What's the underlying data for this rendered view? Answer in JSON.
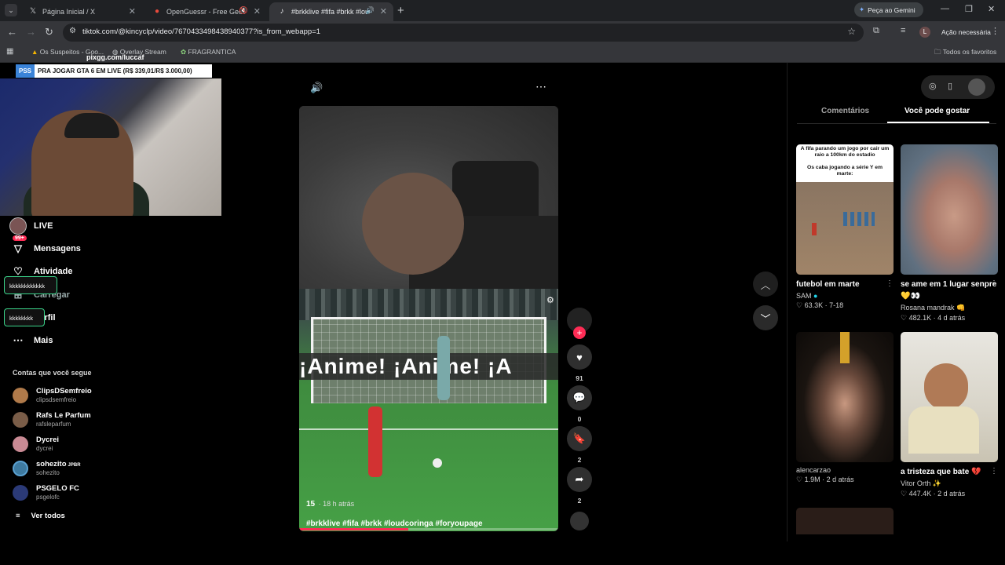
{
  "browser": {
    "tabs": [
      {
        "title": "Página Inicial / X",
        "icon": "x-logo-icon"
      },
      {
        "title": "OpenGuessr - Free GeoGuessr",
        "icon": "openguessr-icon"
      },
      {
        "title": "#brkklive #fifa #brkk #loudc",
        "icon": "tiktok-icon"
      }
    ],
    "new_tab": "+",
    "gemini_label": "Peça ao Gemini",
    "url": "tiktok.com/@kincyclp/video/7670433498438940377?is_from_webapp=1",
    "profile_initial": "L",
    "action_needed": "Ação necessária",
    "bookmarks": [
      "Os Suspeitos - Goo...",
      "Overlay Stream",
      "FRAGRANTICA"
    ],
    "all_bookmarks": "Todos os favoritos"
  },
  "overlay": {
    "pixgg": "pixgg.com/luccaf",
    "pss_tag": "PSS",
    "pss_text": "PRA JOGAR GTA 6 EM LIVE (R$ 339,01/R$ 3.000,00)",
    "chat_1": "kkkkkkkkkkkk",
    "chat_2": "kkkkkkkk"
  },
  "sidebar": {
    "nav": [
      {
        "label": "LIVE"
      },
      {
        "label": "Mensagens",
        "badge": "99+"
      },
      {
        "label": "Atividade"
      },
      {
        "label": "Carregar"
      },
      {
        "label": "Perfil"
      },
      {
        "label": "Mais"
      }
    ],
    "following_title": "Contas que você segue",
    "following": [
      {
        "name": "ClipsDSemfreio",
        "handle": "clipsdsemfreio",
        "color": "#b07a4a"
      },
      {
        "name": "Rafs Le Parfum",
        "handle": "rafsleparfum",
        "color": "#7a5d48"
      },
      {
        "name": "Dycrei",
        "handle": "dycrei",
        "color": "#c98a94"
      },
      {
        "name": "sohezito",
        "suffix": "JPBR",
        "handle": "sohezito",
        "color": "#3e7aa0"
      },
      {
        "name": "PSGELO FC",
        "handle": "psgelofc",
        "color": "#2b3a77"
      }
    ],
    "see_all": "Ver todos"
  },
  "video": {
    "banner_text": "¡Anime! ¡Anime! ¡A",
    "likes_overlay": "15",
    "posted": "· 18 h atrás",
    "hashtags": "#brkklive #fifa #brkk #loudcoringa #foryoupage",
    "progress": 0.42,
    "likes": "91",
    "comments": "0",
    "saves": "2",
    "shares": "2"
  },
  "right_panel": {
    "tabs": [
      "Comentários",
      "Você pode gostar"
    ],
    "active_tab": 1,
    "cards": [
      {
        "overlay": "A fifa parando um jogo por cair um raio a 100km do estadio\n\nOs caba jogando a série Y em marte:",
        "title": "futebol em marte",
        "author": "SAM",
        "verified": true,
        "likes": "63.3K",
        "date": "7-18"
      },
      {
        "title": "se ame em 1 lugar senpre💛👀",
        "author": "Rosana mandrak 👊",
        "likes": "482.1K",
        "date": "4 d atrás"
      },
      {
        "title": "",
        "author": "alencarzao",
        "likes": "1.9M",
        "date": "2 d atrás"
      },
      {
        "title": "a tristeza que bate 💔",
        "author": "Vitor Orth ✨",
        "likes": "447.4K",
        "date": "2 d atrás"
      }
    ]
  }
}
